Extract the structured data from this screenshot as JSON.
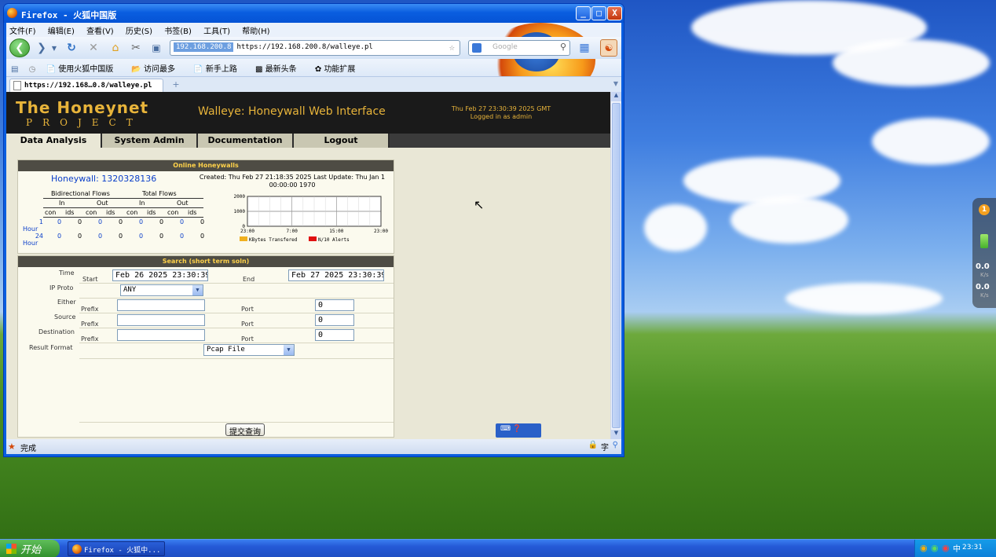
{
  "window": {
    "title": "Firefox - 火狐中国版",
    "buttons": [
      "_",
      "□",
      "X"
    ]
  },
  "menubar": [
    "文件(F)",
    "编辑(E)",
    "查看(V)",
    "历史(S)",
    "书签(B)",
    "工具(T)",
    "帮助(H)"
  ],
  "urlbar": {
    "host": "192.168.200.8",
    "url": "https://192.168.200.8/walleye.pl"
  },
  "search": {
    "placeholder": "Google"
  },
  "bookmarks": [
    "使用火狐中国版",
    "访问最多",
    "新手上路",
    "最新头条",
    "功能扩展"
  ],
  "tab": {
    "label": "https://192.168…0.8/walleye.pl",
    "new": "+"
  },
  "page": {
    "logo_line1": "The Honeynet",
    "logo_line2": "PROJECT",
    "app_title": "Walleye: Honeywall Web Interface",
    "datetime": "Thu Feb 27 23:30:39 2025 GMT",
    "login": "Logged in as admin",
    "nav": [
      "Data Analysis",
      "System Admin",
      "Documentation",
      "Logout"
    ]
  },
  "honeywalls": {
    "heading": "Online Honeywalls",
    "name": "Honeywall: 1320328136",
    "created": "Created: Thu Feb 27 21:18:35 2025 Last Update: Thu Jan 1",
    "created2": "00:00:00 1970",
    "bidir": "Bidirectional Flows",
    "total": "Total Flows",
    "in": "In",
    "out": "Out",
    "cols": [
      "con",
      "ids",
      "con",
      "ids",
      "con",
      "ids",
      "con",
      "ids"
    ],
    "rows": [
      {
        "label1": "1",
        "label2": "Hour",
        "values": [
          "0",
          "0",
          "0",
          "0",
          "0",
          "0",
          "0",
          "0"
        ]
      },
      {
        "label1": "24",
        "label2": "Hour",
        "values": [
          "0",
          "0",
          "0",
          "0",
          "0",
          "0",
          "0",
          "0"
        ]
      }
    ]
  },
  "chart_data": {
    "type": "line",
    "y_ticks": [
      "2000",
      "1000",
      "0"
    ],
    "x_ticks": [
      "23:00",
      "7:00",
      "15:00",
      "23:00"
    ],
    "ylim": [
      0,
      2000
    ],
    "series": [
      {
        "name": "KBytes Transfered",
        "color": "#f0b020"
      },
      {
        "name": "N/10 Alerts",
        "color": "#e01010"
      }
    ]
  },
  "search_form": {
    "heading": "Search (short term soln)",
    "time_label": "Time",
    "start_label": "Start",
    "start_value": "Feb 26 2025 23:30:39",
    "end_label": "End",
    "end_value": "Feb 27 2025 23:30:39",
    "ipproto_label": "IP Proto",
    "ipproto_value": "ANY",
    "either_label": "Either",
    "source_label": "Source",
    "destination_label": "Destination",
    "prefix_label": "Prefix",
    "port_label": "Port",
    "port_value": "0",
    "result_label": "Result Format",
    "result_value": "Pcap File",
    "submit": "提交查询"
  },
  "status": {
    "text": "完成"
  },
  "taskbar": {
    "start": "开始",
    "task": "Firefox - 火狐中...",
    "clock": "23:31"
  },
  "side_widget": {
    "badge": "1",
    "val1": "0.0",
    "unit1": "K/s",
    "val2": "0.0",
    "unit2": "K/s"
  }
}
